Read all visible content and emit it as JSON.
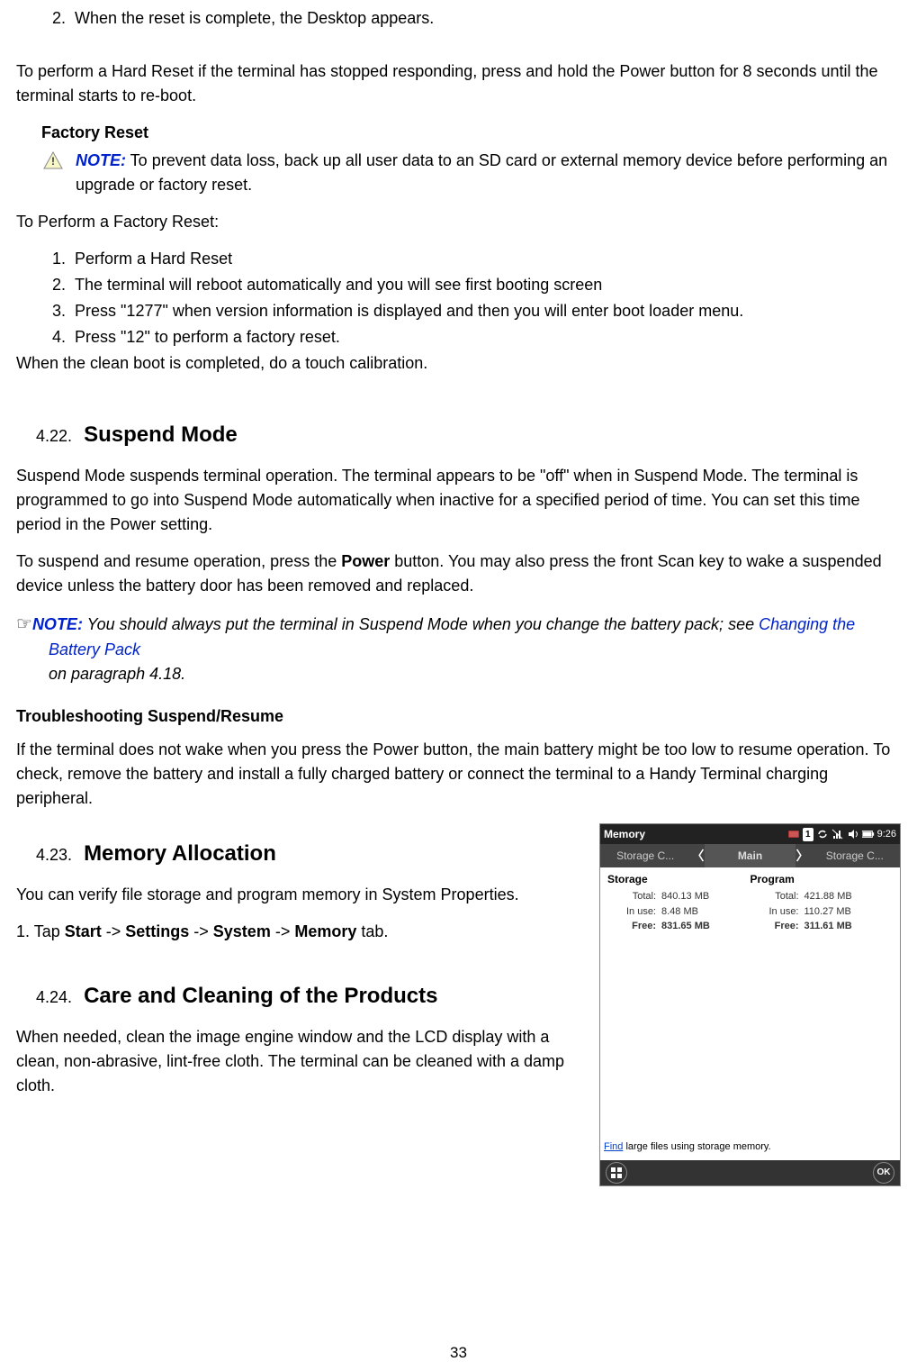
{
  "top_item_num": "2.",
  "top_item_text": "When the reset is complete, the Desktop appears.",
  "hardreset_para": "To perform a Hard Reset if the terminal has stopped responding, press and hold the Power button for 8 seconds until the terminal starts to re-boot.",
  "factory_heading": "Factory Reset",
  "note1_label": "NOTE:",
  "note1_text": " To prevent data loss, back up all user data to an SD card or external memory device before performing an upgrade or factory reset.",
  "factory_intro": "To Perform a Factory Reset:",
  "factory_steps": [
    "Perform a Hard Reset",
    "The terminal will reboot automatically and you will see first booting screen",
    "Press \"1277\" when version information is displayed and then you will enter boot loader menu.",
    "Press \"12\" to perform a factory reset."
  ],
  "factory_after": "When the clean boot is completed, do a touch calibration.",
  "s422_num": "4.22.",
  "s422_title": "Suspend Mode",
  "s422_p1": "Suspend Mode suspends terminal operation. The terminal appears to be \"off\" when in Suspend Mode. The terminal is programmed to go into Suspend Mode automatically when inactive for a specified period of time. You can set this time period in the Power setting.",
  "s422_p2a": "To suspend and resume operation, press the ",
  "s422_p2_bold": "Power",
  "s422_p2b": " button. You may also press the front Scan key to wake a suspended device unless the battery door has been removed and replaced.",
  "note2_label": "NOTE:",
  "note2_a": " You should always put the terminal in Suspend Mode when you change the battery pack; see ",
  "note2_link": "Changing the Battery Pack",
  "note2_b": " on paragraph 4.18.",
  "trouble_head": "Troubleshooting Suspend/Resume",
  "trouble_p": "If the terminal does not wake when you press the Power button, the main battery might be too low to resume operation. To check, remove the battery and install a fully charged battery or connect the terminal to a Handy Terminal charging peripheral.",
  "s423_num": "4.23.",
  "s423_title": "Memory Allocation",
  "s423_p1": "You can verify file storage and program memory in System Properties.",
  "s423_p2_parts": [
    "1. Tap ",
    "Start",
    " -> ",
    "Settings",
    " -> ",
    "System",
    " -> ",
    "Memory",
    " tab."
  ],
  "s424_num": "4.24.",
  "s424_title": "Care and Cleaning of the Products",
  "s424_p": "When needed, clean the image engine window and the LCD display with a clean, non-abrasive, lint-free cloth. The terminal can be cleaned with a damp cloth.",
  "pagenum": "33",
  "screenshot": {
    "title": "Memory",
    "time": "9:26",
    "tab_left": "Storage C...",
    "tab_mid": "Main",
    "tab_right": "Storage C...",
    "col1": "Storage",
    "col2": "Program",
    "storage": {
      "total": "840.13 MB",
      "inuse": "8.48 MB",
      "free": "831.65 MB"
    },
    "program": {
      "total": "421.88 MB",
      "inuse": "110.27 MB",
      "free": "311.61 MB"
    },
    "labels": {
      "total": "Total:",
      "inuse": "In use:",
      "free": "Free:"
    },
    "footer_link": "Find",
    "footer_rest": " large files using storage memory.",
    "ok": "OK",
    "sig_badge": "1"
  }
}
